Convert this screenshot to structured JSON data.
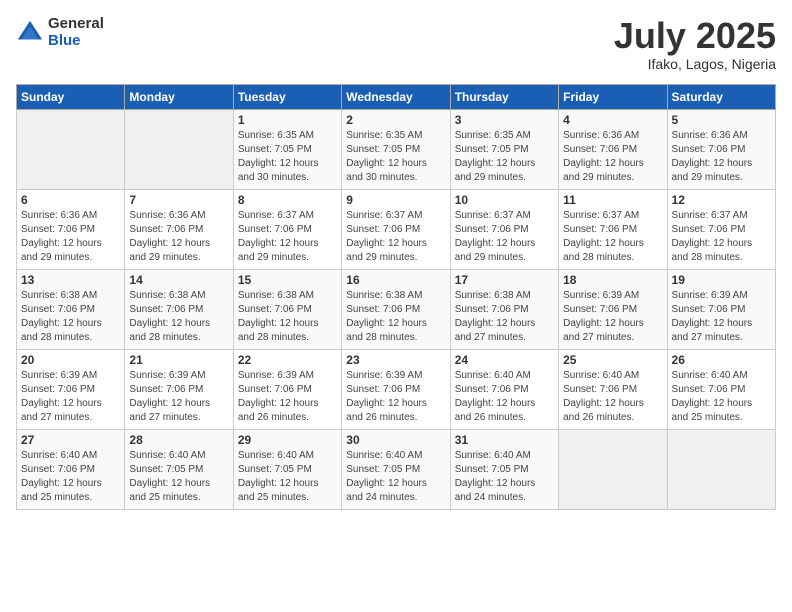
{
  "logo": {
    "general": "General",
    "blue": "Blue"
  },
  "header": {
    "month": "July 2025",
    "location": "Ifako, Lagos, Nigeria"
  },
  "weekdays": [
    "Sunday",
    "Monday",
    "Tuesday",
    "Wednesday",
    "Thursday",
    "Friday",
    "Saturday"
  ],
  "weeks": [
    [
      {
        "day": "",
        "sunrise": "",
        "sunset": "",
        "daylight": ""
      },
      {
        "day": "",
        "sunrise": "",
        "sunset": "",
        "daylight": ""
      },
      {
        "day": "1",
        "sunrise": "Sunrise: 6:35 AM",
        "sunset": "Sunset: 7:05 PM",
        "daylight": "Daylight: 12 hours and 30 minutes."
      },
      {
        "day": "2",
        "sunrise": "Sunrise: 6:35 AM",
        "sunset": "Sunset: 7:05 PM",
        "daylight": "Daylight: 12 hours and 30 minutes."
      },
      {
        "day": "3",
        "sunrise": "Sunrise: 6:35 AM",
        "sunset": "Sunset: 7:05 PM",
        "daylight": "Daylight: 12 hours and 29 minutes."
      },
      {
        "day": "4",
        "sunrise": "Sunrise: 6:36 AM",
        "sunset": "Sunset: 7:06 PM",
        "daylight": "Daylight: 12 hours and 29 minutes."
      },
      {
        "day": "5",
        "sunrise": "Sunrise: 6:36 AM",
        "sunset": "Sunset: 7:06 PM",
        "daylight": "Daylight: 12 hours and 29 minutes."
      }
    ],
    [
      {
        "day": "6",
        "sunrise": "Sunrise: 6:36 AM",
        "sunset": "Sunset: 7:06 PM",
        "daylight": "Daylight: 12 hours and 29 minutes."
      },
      {
        "day": "7",
        "sunrise": "Sunrise: 6:36 AM",
        "sunset": "Sunset: 7:06 PM",
        "daylight": "Daylight: 12 hours and 29 minutes."
      },
      {
        "day": "8",
        "sunrise": "Sunrise: 6:37 AM",
        "sunset": "Sunset: 7:06 PM",
        "daylight": "Daylight: 12 hours and 29 minutes."
      },
      {
        "day": "9",
        "sunrise": "Sunrise: 6:37 AM",
        "sunset": "Sunset: 7:06 PM",
        "daylight": "Daylight: 12 hours and 29 minutes."
      },
      {
        "day": "10",
        "sunrise": "Sunrise: 6:37 AM",
        "sunset": "Sunset: 7:06 PM",
        "daylight": "Daylight: 12 hours and 29 minutes."
      },
      {
        "day": "11",
        "sunrise": "Sunrise: 6:37 AM",
        "sunset": "Sunset: 7:06 PM",
        "daylight": "Daylight: 12 hours and 28 minutes."
      },
      {
        "day": "12",
        "sunrise": "Sunrise: 6:37 AM",
        "sunset": "Sunset: 7:06 PM",
        "daylight": "Daylight: 12 hours and 28 minutes."
      }
    ],
    [
      {
        "day": "13",
        "sunrise": "Sunrise: 6:38 AM",
        "sunset": "Sunset: 7:06 PM",
        "daylight": "Daylight: 12 hours and 28 minutes."
      },
      {
        "day": "14",
        "sunrise": "Sunrise: 6:38 AM",
        "sunset": "Sunset: 7:06 PM",
        "daylight": "Daylight: 12 hours and 28 minutes."
      },
      {
        "day": "15",
        "sunrise": "Sunrise: 6:38 AM",
        "sunset": "Sunset: 7:06 PM",
        "daylight": "Daylight: 12 hours and 28 minutes."
      },
      {
        "day": "16",
        "sunrise": "Sunrise: 6:38 AM",
        "sunset": "Sunset: 7:06 PM",
        "daylight": "Daylight: 12 hours and 28 minutes."
      },
      {
        "day": "17",
        "sunrise": "Sunrise: 6:38 AM",
        "sunset": "Sunset: 7:06 PM",
        "daylight": "Daylight: 12 hours and 27 minutes."
      },
      {
        "day": "18",
        "sunrise": "Sunrise: 6:39 AM",
        "sunset": "Sunset: 7:06 PM",
        "daylight": "Daylight: 12 hours and 27 minutes."
      },
      {
        "day": "19",
        "sunrise": "Sunrise: 6:39 AM",
        "sunset": "Sunset: 7:06 PM",
        "daylight": "Daylight: 12 hours and 27 minutes."
      }
    ],
    [
      {
        "day": "20",
        "sunrise": "Sunrise: 6:39 AM",
        "sunset": "Sunset: 7:06 PM",
        "daylight": "Daylight: 12 hours and 27 minutes."
      },
      {
        "day": "21",
        "sunrise": "Sunrise: 6:39 AM",
        "sunset": "Sunset: 7:06 PM",
        "daylight": "Daylight: 12 hours and 27 minutes."
      },
      {
        "day": "22",
        "sunrise": "Sunrise: 6:39 AM",
        "sunset": "Sunset: 7:06 PM",
        "daylight": "Daylight: 12 hours and 26 minutes."
      },
      {
        "day": "23",
        "sunrise": "Sunrise: 6:39 AM",
        "sunset": "Sunset: 7:06 PM",
        "daylight": "Daylight: 12 hours and 26 minutes."
      },
      {
        "day": "24",
        "sunrise": "Sunrise: 6:40 AM",
        "sunset": "Sunset: 7:06 PM",
        "daylight": "Daylight: 12 hours and 26 minutes."
      },
      {
        "day": "25",
        "sunrise": "Sunrise: 6:40 AM",
        "sunset": "Sunset: 7:06 PM",
        "daylight": "Daylight: 12 hours and 26 minutes."
      },
      {
        "day": "26",
        "sunrise": "Sunrise: 6:40 AM",
        "sunset": "Sunset: 7:06 PM",
        "daylight": "Daylight: 12 hours and 25 minutes."
      }
    ],
    [
      {
        "day": "27",
        "sunrise": "Sunrise: 6:40 AM",
        "sunset": "Sunset: 7:06 PM",
        "daylight": "Daylight: 12 hours and 25 minutes."
      },
      {
        "day": "28",
        "sunrise": "Sunrise: 6:40 AM",
        "sunset": "Sunset: 7:05 PM",
        "daylight": "Daylight: 12 hours and 25 minutes."
      },
      {
        "day": "29",
        "sunrise": "Sunrise: 6:40 AM",
        "sunset": "Sunset: 7:05 PM",
        "daylight": "Daylight: 12 hours and 25 minutes."
      },
      {
        "day": "30",
        "sunrise": "Sunrise: 6:40 AM",
        "sunset": "Sunset: 7:05 PM",
        "daylight": "Daylight: 12 hours and 24 minutes."
      },
      {
        "day": "31",
        "sunrise": "Sunrise: 6:40 AM",
        "sunset": "Sunset: 7:05 PM",
        "daylight": "Daylight: 12 hours and 24 minutes."
      },
      {
        "day": "",
        "sunrise": "",
        "sunset": "",
        "daylight": ""
      },
      {
        "day": "",
        "sunrise": "",
        "sunset": "",
        "daylight": ""
      }
    ]
  ]
}
